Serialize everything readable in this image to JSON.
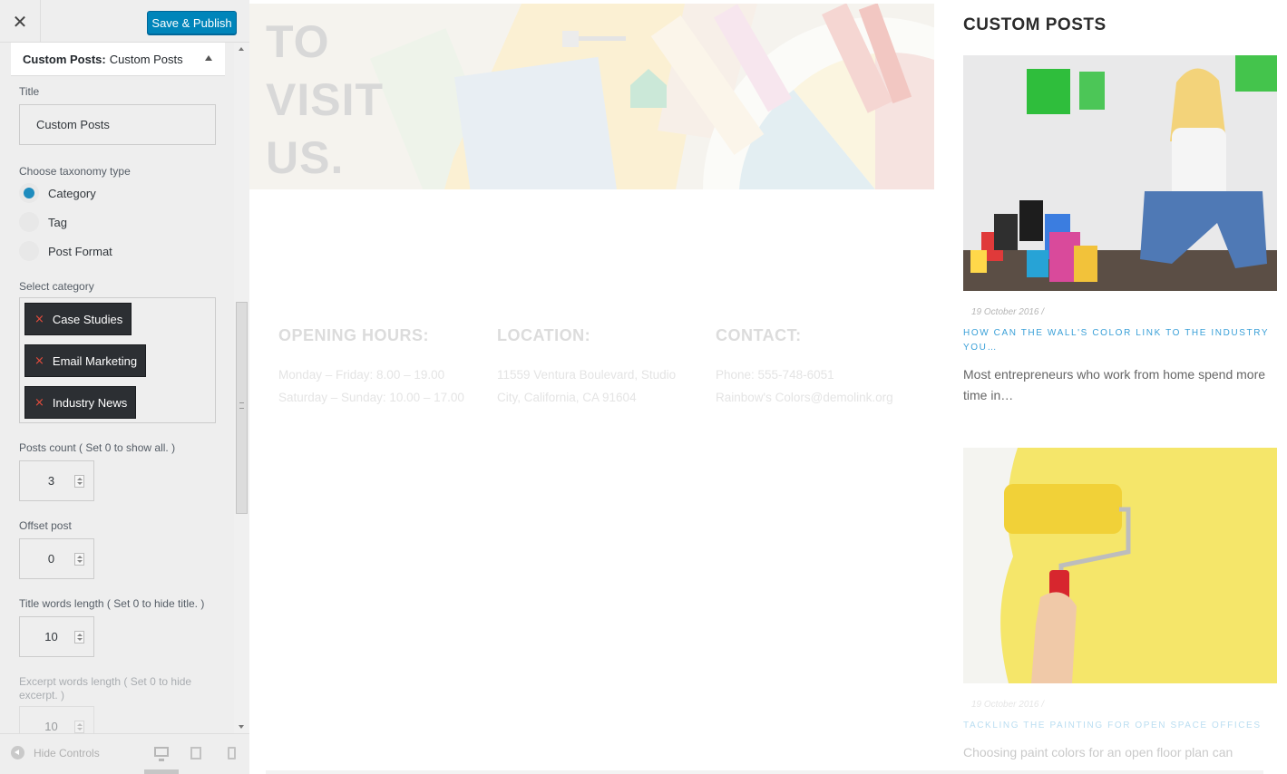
{
  "sidebar": {
    "close_label": "✕",
    "publish_label": "Save & Publish",
    "section": {
      "prefix": "Custom Posts:",
      "name": "Custom Posts"
    },
    "title_label": "Title",
    "title_value": "Custom Posts",
    "taxonomy_label": "Choose taxonomy type",
    "taxonomy_options": [
      "Category",
      "Tag",
      "Post Format"
    ],
    "taxonomy_selected": "Category",
    "category_label": "Select category",
    "categories": [
      "Case Studies",
      "Email Marketing",
      "Industry News"
    ],
    "chip_remove_glyph": "×",
    "posts_count_label": "Posts count ( Set 0 to show all. )",
    "posts_count_value": "3",
    "offset_label": "Offset post",
    "offset_value": "0",
    "title_words_label": "Title words length ( Set 0 to hide title. )",
    "title_words_value": "10",
    "excerpt_words_label": "Excerpt words length ( Set 0 to hide excerpt. )",
    "excerpt_words_value": "10",
    "hide_controls_label": "Hide Controls",
    "devices": [
      "desktop-icon",
      "tablet-icon",
      "mobile-icon"
    ],
    "accent_color": "#0085ba"
  },
  "preview": {
    "hero": {
      "line1": "TO",
      "line2": "VISIT",
      "line3": "US."
    },
    "info": {
      "hours": {
        "heading": "OPENING HOURS:",
        "line1": "Monday – Friday: 8.00 – 19.00",
        "line2": "Saturday – Sunday: 10.00 – 17.00"
      },
      "location": {
        "heading": "LOCATION:",
        "line1": "11559 Ventura Boulevard, Studio",
        "line2": "City, California, CA 91604"
      },
      "contact": {
        "heading": "CONTACT:",
        "line1": "Phone: 555-748-6051",
        "line2": "Rainbow's Colors@demolink.org"
      }
    },
    "widget": {
      "title": "CUSTOM POSTS",
      "posts": [
        {
          "date": "19 October 2016 /",
          "title": "HOW CAN THE WALL'S COLOR LINK TO THE INDUSTRY YOU…",
          "excerpt": "Most entrepreneurs who work from home spend more time in…"
        },
        {
          "date": "19 October 2016 /",
          "title": "TACKLING THE PAINTING FOR OPEN SPACE OFFICES",
          "excerpt": "Choosing paint colors for an open floor plan can seem…"
        }
      ]
    },
    "link_color": "#3aa0d8"
  }
}
